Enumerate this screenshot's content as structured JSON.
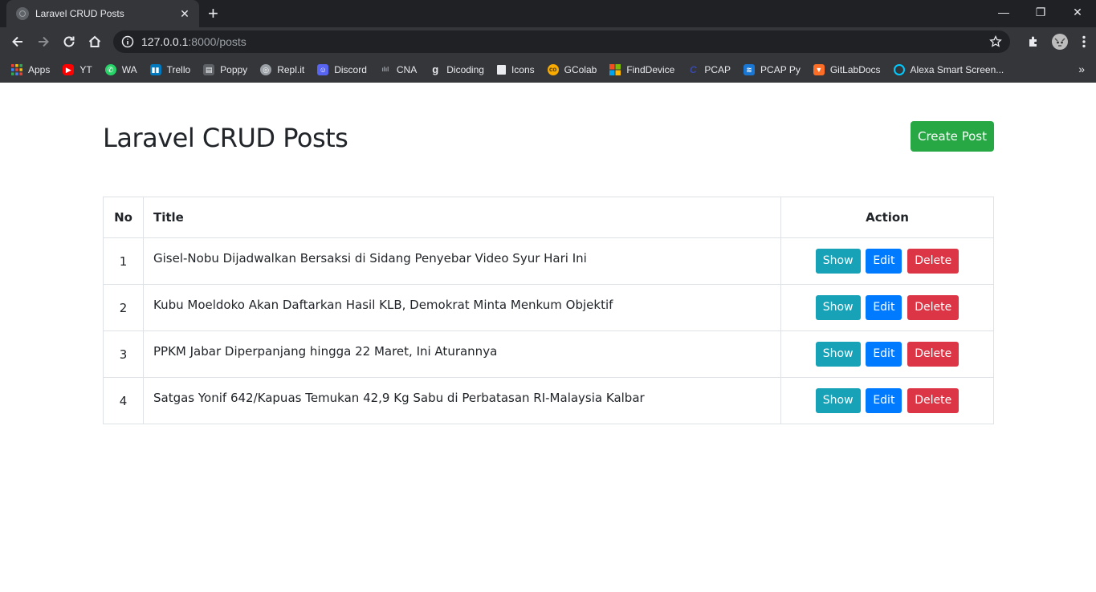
{
  "browser": {
    "tab_title": "Laravel CRUD Posts",
    "tab_close": "✕",
    "new_tab": "+",
    "url_host": "127.0.0.1",
    "url_path": ":8000/posts",
    "window_controls": {
      "minimize": "—",
      "restore": "❐",
      "close": "✕"
    },
    "bookmarks": [
      {
        "label": "Apps",
        "icon": "apps-grid-icon",
        "color": "#ea4335"
      },
      {
        "label": "YT",
        "icon": "youtube-icon",
        "color": "#ff0000"
      },
      {
        "label": "WA",
        "icon": "whatsapp-icon",
        "color": "#25d366"
      },
      {
        "label": "Trello",
        "icon": "trello-icon",
        "color": "#0079bf"
      },
      {
        "label": "Poppy",
        "icon": "poppy-icon",
        "color": "#9aa0a6"
      },
      {
        "label": "Repl.it",
        "icon": "replit-icon",
        "color": "#9aa0a6"
      },
      {
        "label": "Discord",
        "icon": "discord-icon",
        "color": "#5865f2"
      },
      {
        "label": "CNA",
        "icon": "cisco-icon",
        "color": "#9aa0a6"
      },
      {
        "label": "Dicoding",
        "icon": "dicoding-icon",
        "color": "#e8eaed"
      },
      {
        "label": "Icons",
        "icon": "icons-icon",
        "color": "#e8eaed"
      },
      {
        "label": "GColab",
        "icon": "colab-icon",
        "color": "#f9ab00"
      },
      {
        "label": "FindDevice",
        "icon": "microsoft-icon",
        "color": "#f25022"
      },
      {
        "label": "PCAP",
        "icon": "pcap-icon",
        "color": "#1a237e"
      },
      {
        "label": "PCAP Py",
        "icon": "pcap-py-icon",
        "color": "#1976d2"
      },
      {
        "label": "GitLabDocs",
        "icon": "gitlab-icon",
        "color": "#fc6d26"
      },
      {
        "label": "Alexa Smart Screen...",
        "icon": "alexa-icon",
        "color": "#00caff"
      }
    ]
  },
  "page": {
    "title": "Laravel CRUD Posts",
    "create_button": "Create Post",
    "table": {
      "headers": {
        "no": "No",
        "title": "Title",
        "action": "Action"
      },
      "rows": [
        {
          "no": "1",
          "title": "Gisel-Nobu Dijadwalkan Bersaksi di Sidang Penyebar Video Syur Hari Ini"
        },
        {
          "no": "2",
          "title": "Kubu Moeldoko Akan Daftarkan Hasil KLB, Demokrat Minta Menkum Objektif"
        },
        {
          "no": "3",
          "title": "PPKM Jabar Diperpanjang hingga 22 Maret, Ini Aturannya"
        },
        {
          "no": "4",
          "title": "Satgas Yonif 642/Kapuas Temukan 42,9 Kg Sabu di Perbatasan RI-Malaysia Kalbar"
        }
      ],
      "actions": {
        "show": "Show",
        "edit": "Edit",
        "delete": "Delete"
      }
    }
  },
  "colors": {
    "success": "#28a745",
    "info": "#17a2b8",
    "primary": "#007bff",
    "danger": "#dc3545"
  }
}
